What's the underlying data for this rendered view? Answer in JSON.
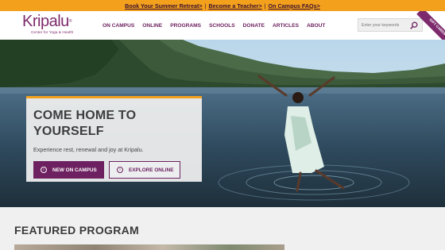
{
  "promo": {
    "links": [
      "Book Your Summer Retreat>",
      "Become a Teacher>",
      "On Campus FAQs>"
    ],
    "separator": "|"
  },
  "header": {
    "logo_text": "Kripalu",
    "logo_tagline": "Center for Yoga & Health",
    "nav": [
      "ON CAMPUS",
      "ONLINE",
      "PROGRAMS",
      "SCHOOLS",
      "DONATE",
      "ARTICLES",
      "ABOUT"
    ],
    "search_placeholder": "Enter your keywords",
    "gift_label": "GIFT CARDS"
  },
  "hero": {
    "title": "COME HOME TO YOURSELF",
    "subtitle": "Experience rest, renewal and joy at Kripalu.",
    "primary_button": "NEW ON CAMPUS",
    "secondary_button": "EXPLORE ONLINE"
  },
  "featured": {
    "title": "FEATURED PROGRAM"
  },
  "colors": {
    "brand_purple": "#6d2160",
    "accent_orange": "#f3a11d"
  }
}
